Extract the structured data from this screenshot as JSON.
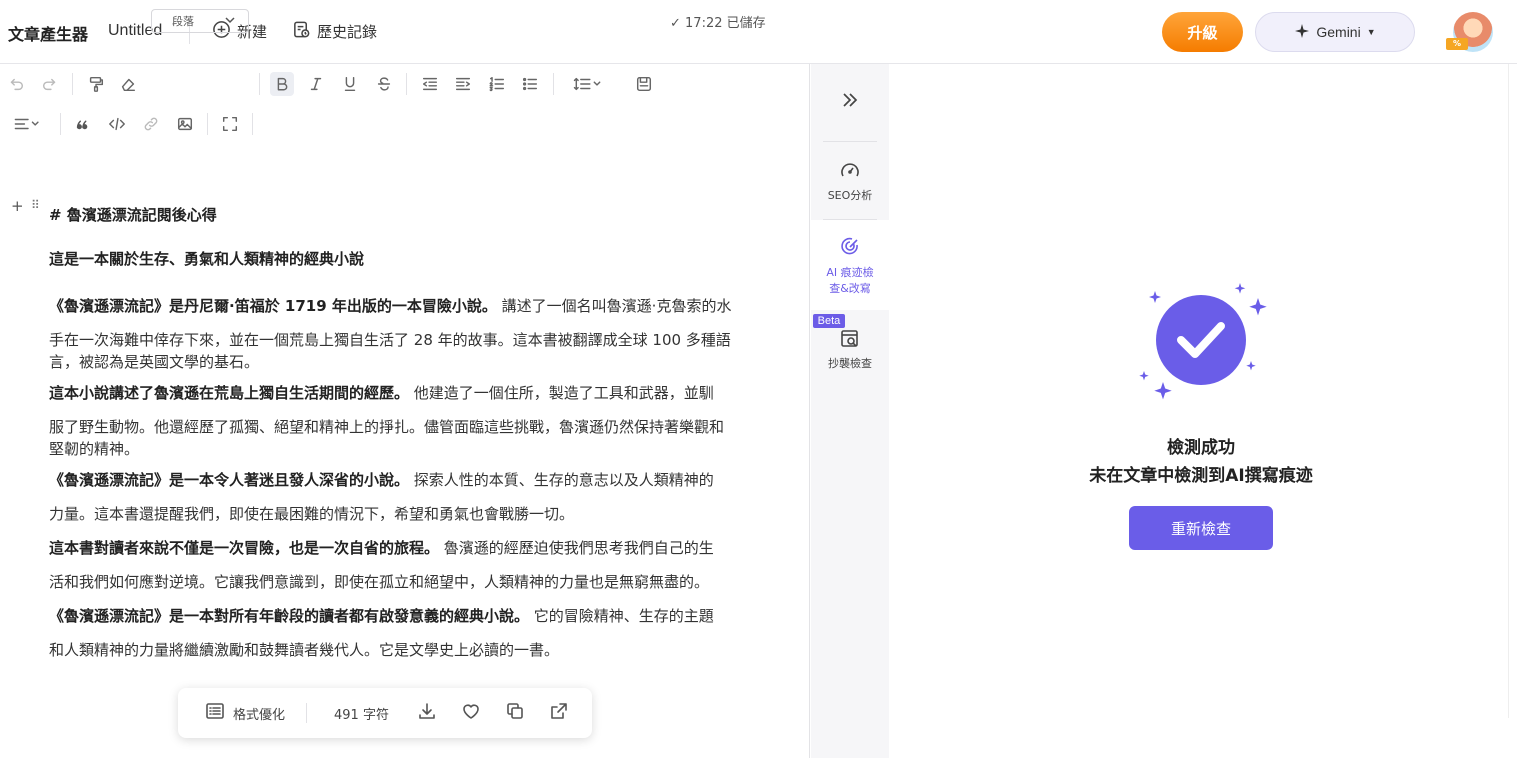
{
  "header": {
    "app_title": "文章產生器",
    "doc_title": "Untitled",
    "new_label": "新建",
    "history_label": "歷史記錄",
    "upgrade_label": "升級",
    "model_label": "Gemini",
    "avatar_badge": "%"
  },
  "toolbar": {
    "paragraph_select": "段落",
    "saved_status": "✓ 17:22 已儲存"
  },
  "document": {
    "heading": "# 魯濱遜漂流記閱後心得",
    "subheading": "這是一本關於生存、勇氣和人類精神的經典小說",
    "paragraphs": [
      {
        "bold": "《魯濱遜漂流記》是丹尼爾·笛福於 1719 年出版的一本冒險小說。",
        "rest_line1": " 講述了一個名叫魯濱遜·克魯索的水",
        "line2": "手在一次海難中倖存下來，並在一個荒島上獨自生活了 28 年的故事。這本書被翻譯成全球 100 多種語",
        "line3": "言，被認為是英國文學的基石。"
      },
      {
        "bold": "這本小說講述了魯濱遜在荒島上獨自生活期間的經歷。",
        "rest_line1": " 他建造了一個住所，製造了工具和武器，並馴",
        "line2": "服了野生動物。他還經歷了孤獨、絕望和精神上的掙扎。儘管面臨這些挑戰，魯濱遜仍然保持著樂觀和",
        "line3": "堅韌的精神。"
      },
      {
        "bold": "《魯濱遜漂流記》是一本令人著迷且發人深省的小說。",
        "rest_line1": " 探索人性的本質、生存的意志以及人類精神的",
        "line2": "力量。這本書還提醒我們，即使在最困難的情況下，希望和勇氣也會戰勝一切。"
      },
      {
        "bold": "這本書對讀者來說不僅是一次冒險，也是一次自省的旅程。",
        "rest_line1": " 魯濱遜的經歷迫使我們思考我們自己的生",
        "line2": "活和我們如何應對逆境。它讓我們意識到，即使在孤立和絕望中，人類精神的力量也是無窮無盡的。"
      },
      {
        "bold": "《魯濱遜漂流記》是一本對所有年齡段的讀者都有啟發意義的經典小說。",
        "rest_line1": " 它的冒險精神、生存的主題",
        "line2": "和人類精神的力量將繼續激勵和鼓舞讀者幾代人。它是文學史上必讀的一書。"
      }
    ]
  },
  "bottom_bar": {
    "format_label": "格式優化",
    "word_count": "491 字符"
  },
  "side_rail": {
    "seo_label": "SEO分析",
    "ai_label_line1": "AI 痕迹檢",
    "ai_label_line2": "查&改寫",
    "beta_label": "Beta",
    "plagiarism_label": "抄襲檢查"
  },
  "result": {
    "title": "檢測成功",
    "description": "未在文章中檢測到AI撰寫痕迹",
    "recheck_label": "重新檢查"
  },
  "colors": {
    "accent": "#6a5de8",
    "upgrade": "#f78a14"
  }
}
